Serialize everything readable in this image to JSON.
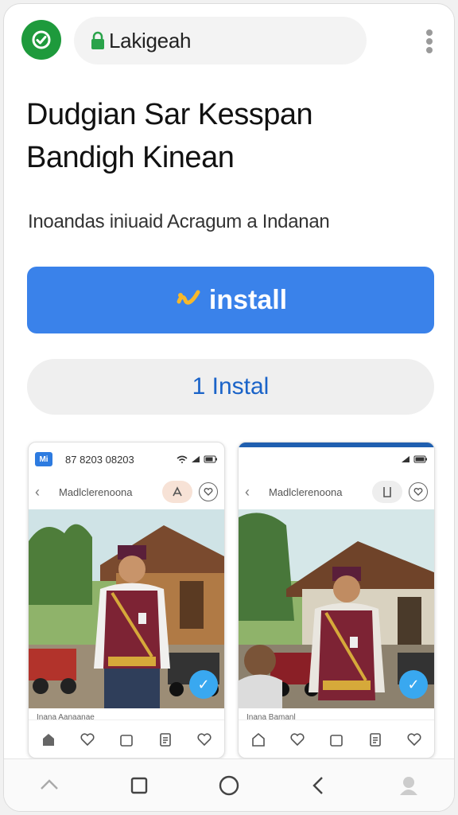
{
  "browser": {
    "url": "Lakigeah",
    "status_icon": "check-icon",
    "menu_icon": "more-vert-icon"
  },
  "page": {
    "title_line1": "Dudgian Sar Kesspan",
    "title_line2": "Bandigh Kinean",
    "subtitle": "Inoandas iniuaid Acragum a Indanan"
  },
  "buttons": {
    "primary_label": "install",
    "secondary_label": "1 Instal"
  },
  "screenshots": [
    {
      "status_time": "87 8203 08203",
      "nav_title": "Madlclerenoona",
      "caption": "Inana Aanaanae"
    },
    {
      "status_time": "",
      "nav_title": "Madlclerenoona",
      "caption": "Inana Bamanl"
    }
  ],
  "colors": {
    "accent_blue": "#3a82ea",
    "badge_green": "#1e9a3c",
    "link_blue": "#1a63c8"
  }
}
